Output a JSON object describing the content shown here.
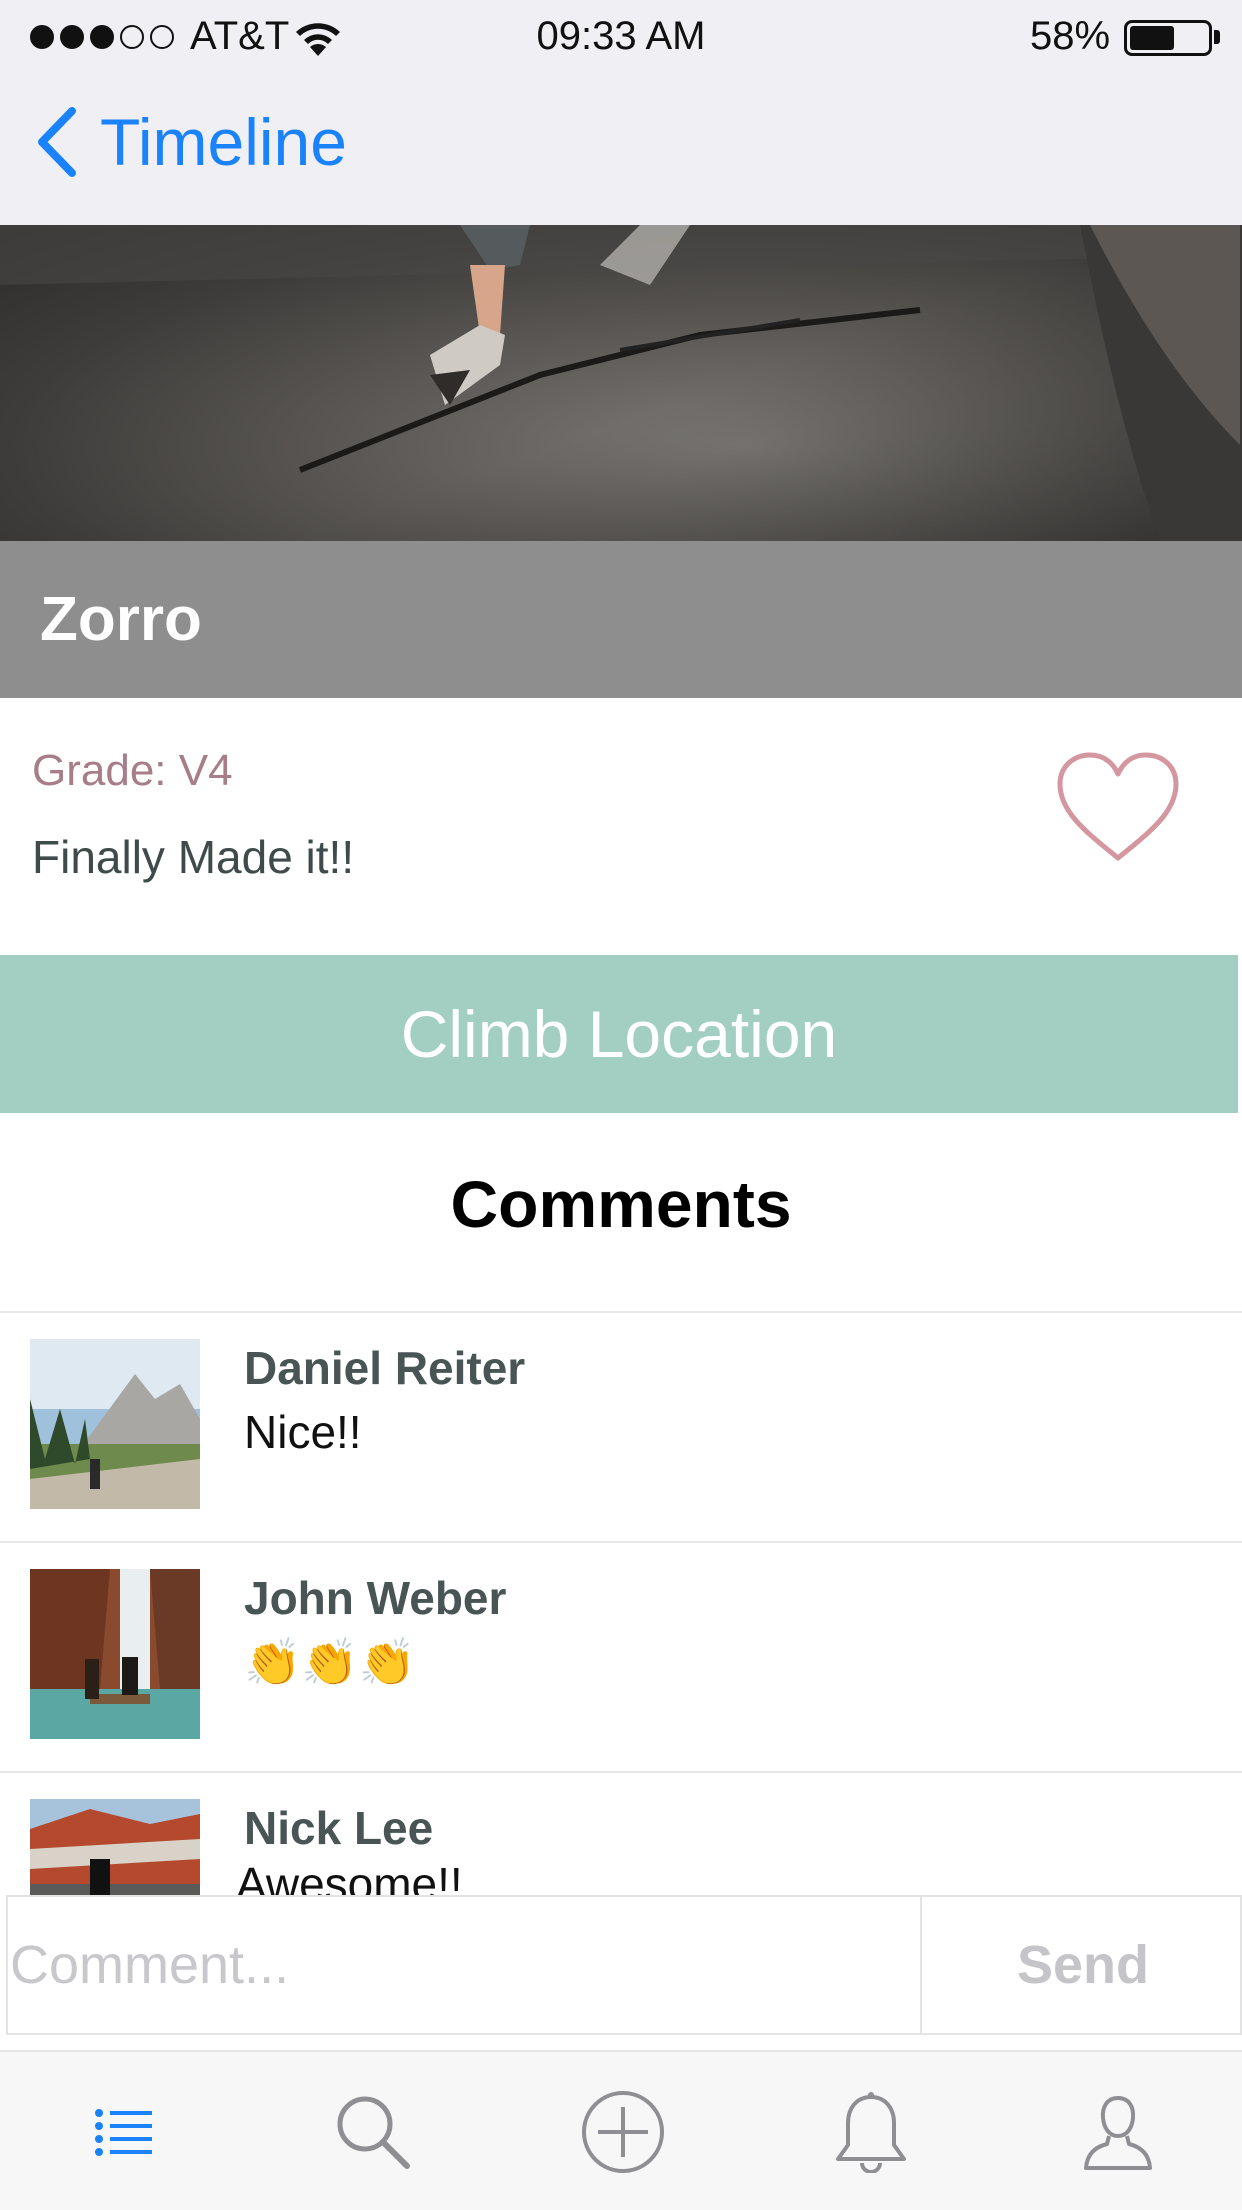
{
  "status_bar": {
    "carrier": "AT&T",
    "signal_bars": 3,
    "signal_total": 5,
    "time": "09:33 AM",
    "battery_percent": "58%",
    "battery_level": 0.58
  },
  "nav": {
    "back_label": "Timeline"
  },
  "post": {
    "route_name": "Zorro",
    "grade": "Grade: V4",
    "caption": "Finally Made it!!",
    "location_button": "Climb Location"
  },
  "comments": {
    "heading": "Comments",
    "items": [
      {
        "name": "Daniel Reiter",
        "text": "Nice!!"
      },
      {
        "name": "John Weber",
        "text": "👏👏👏"
      },
      {
        "name": "Nick Lee",
        "text": "Awesome!!"
      }
    ]
  },
  "comment_input": {
    "placeholder": "Comment...",
    "send_label": "Send"
  },
  "tab_bar": {
    "tabs": [
      {
        "icon": "list-icon",
        "active": true
      },
      {
        "icon": "search-icon",
        "active": false
      },
      {
        "icon": "add-icon",
        "active": false
      },
      {
        "icon": "bell-icon",
        "active": false
      },
      {
        "icon": "profile-icon",
        "active": false
      }
    ]
  },
  "colors": {
    "accent_blue": "#1a82fb",
    "location_button": "#a3cfc3",
    "title_band": "#8e8e8e",
    "grade_text": "#a77d88",
    "heart": "#d4979f"
  }
}
